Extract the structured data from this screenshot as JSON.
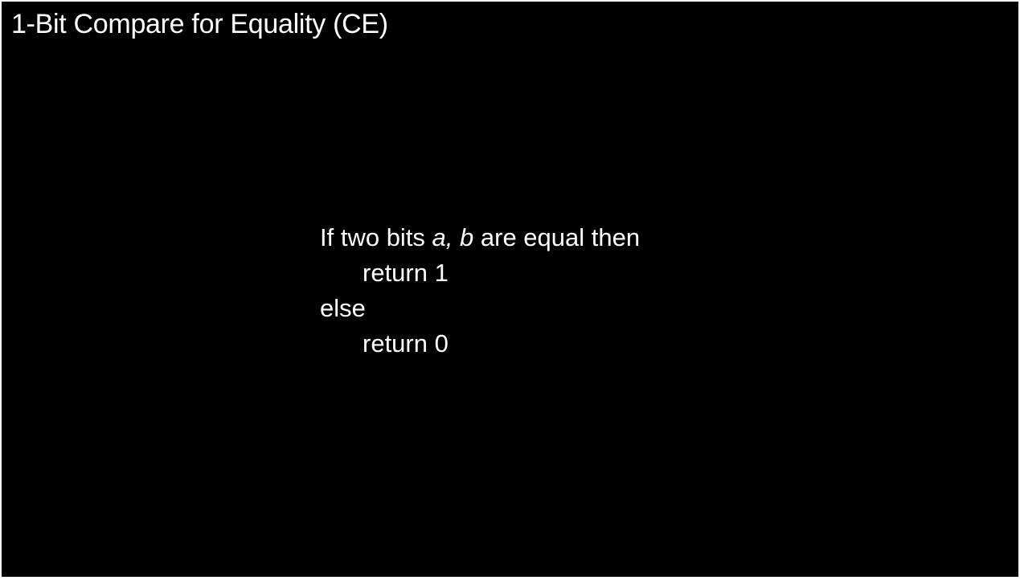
{
  "slide": {
    "title": "1-Bit Compare for Equality (CE)",
    "pseudocode": {
      "line1_prefix": "If two bits ",
      "var_a": "a,",
      "space": " ",
      "var_b": "b",
      "line1_suffix": " are equal then",
      "line2": "return 1",
      "line3": "else",
      "line4": "return 0"
    }
  }
}
